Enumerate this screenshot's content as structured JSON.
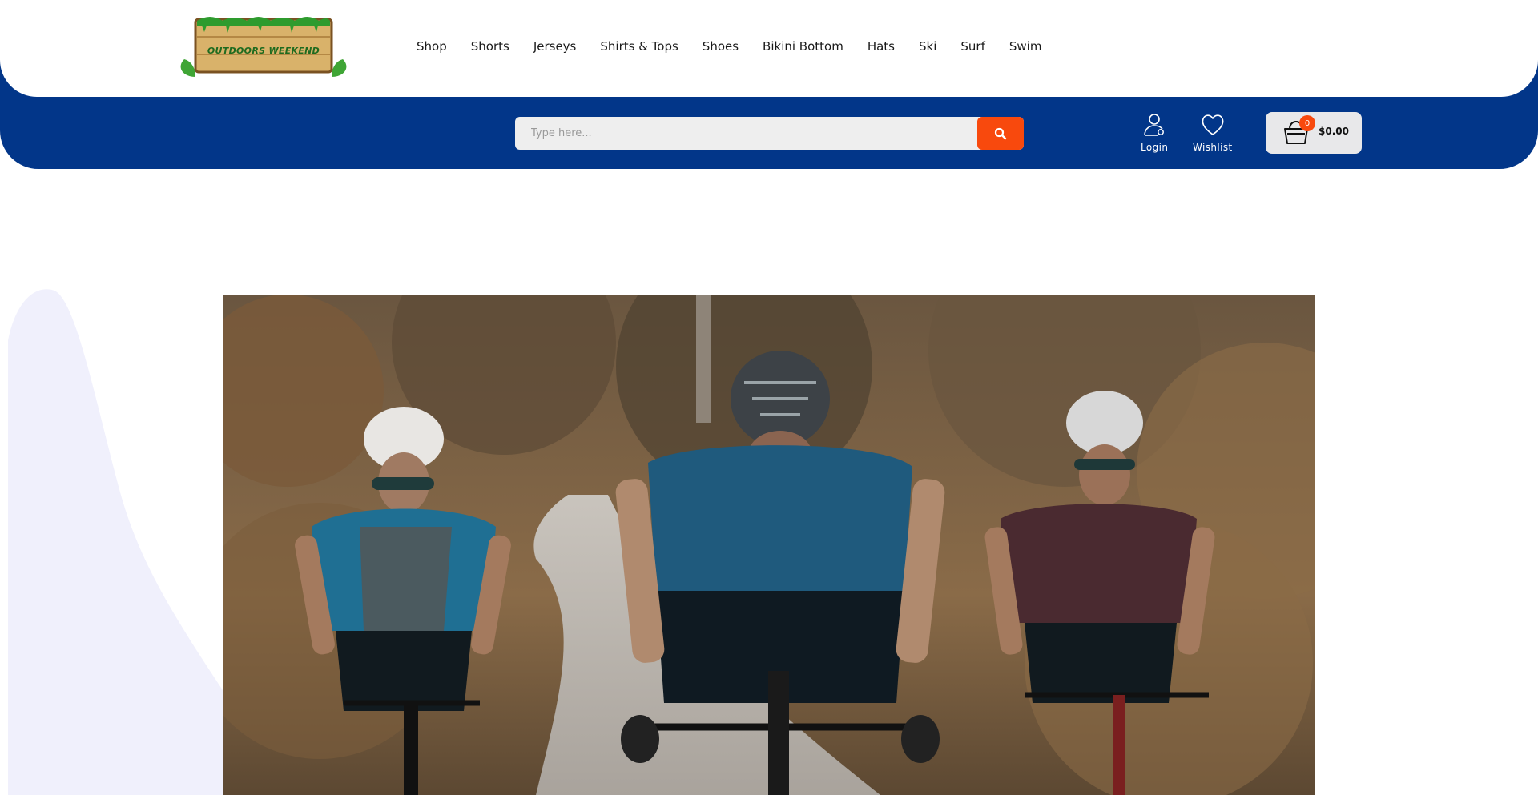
{
  "brand": {
    "logo_text": "OUTDOORS WEEKEND"
  },
  "nav": {
    "items": [
      {
        "label": "Shop"
      },
      {
        "label": "Shorts"
      },
      {
        "label": "Jerseys"
      },
      {
        "label": "Shirts & Tops"
      },
      {
        "label": "Shoes"
      },
      {
        "label": "Bikini Bottom"
      },
      {
        "label": "Hats"
      },
      {
        "label": "Ski"
      },
      {
        "label": "Surf"
      },
      {
        "label": "Swim"
      }
    ]
  },
  "search": {
    "placeholder": "Type here...",
    "value": "",
    "button_icon": "search-icon"
  },
  "actions": {
    "login_label": "Login",
    "login_icon": "user-icon",
    "wishlist_label": "Wishlist",
    "wishlist_icon": "heart-icon"
  },
  "cart": {
    "count": "0",
    "total": "$0.00",
    "icon": "shopping-basket-icon"
  },
  "hero": {
    "image_description": "three cyclists riding on a forest road"
  },
  "colors": {
    "brand_blue": "#023689",
    "accent_orange": "#f8490d",
    "blob": "#f0f0fc"
  }
}
